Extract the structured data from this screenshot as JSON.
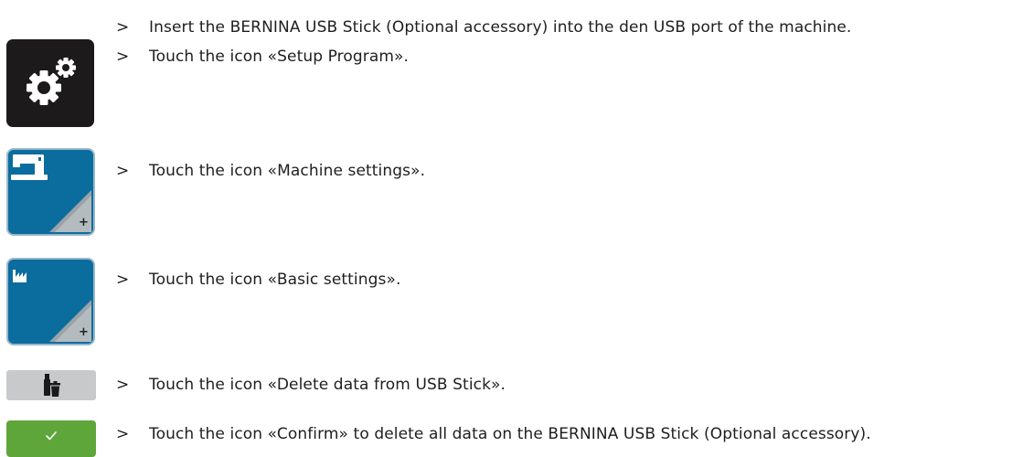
{
  "steps": [
    {
      "marker": ">",
      "text": "Insert the BERNINA USB Stick (Optional accessory) into the den USB port of the machine.",
      "icon": null
    },
    {
      "marker": ">",
      "text": "Touch the icon «Setup Program».",
      "icon": "setup-program-icon"
    },
    {
      "marker": ">",
      "text": "Touch the icon «Machine settings».",
      "icon": "machine-settings-icon"
    },
    {
      "marker": ">",
      "text": "Touch the icon «Basic settings».",
      "icon": "basic-settings-icon"
    },
    {
      "marker": ">",
      "text": "Touch the icon «Delete data from USB Stick».",
      "icon": "delete-usb-data-icon"
    },
    {
      "marker": ">",
      "text": "Touch the icon «Confirm» to delete all data on the BERNINA USB Stick (Optional accessory).",
      "icon": "confirm-icon"
    }
  ],
  "colors": {
    "setup_bg": "#1c1a1a",
    "settings_bg": "#0b6c9e",
    "delete_bg": "#c8c9cb",
    "confirm_bg": "#5fa63a",
    "text": "#1e1e1e"
  }
}
